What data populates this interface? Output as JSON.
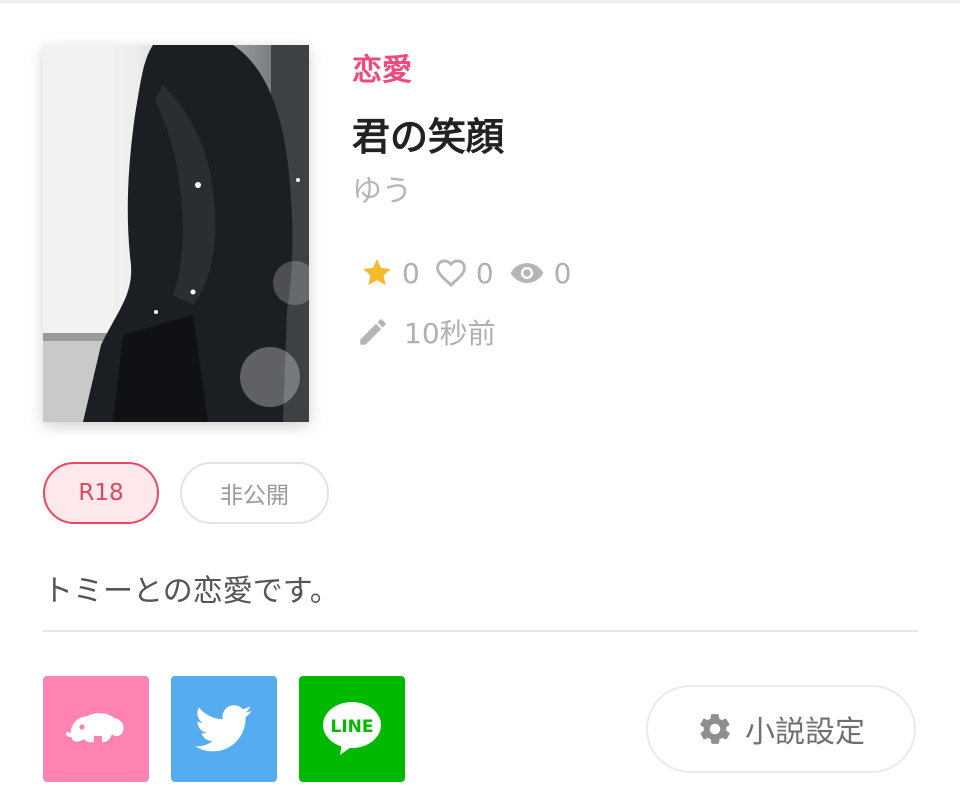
{
  "novel": {
    "genre": "恋愛",
    "title": "君の笑顔",
    "author": "ゆう",
    "stats": {
      "stars": "0",
      "likes": "0",
      "views": "0"
    },
    "updated": "10秒前",
    "tags": {
      "rating": "R18",
      "visibility": "非公開"
    },
    "description": "トミーとの恋愛です。"
  },
  "share": {
    "line_label": "LINE"
  },
  "settings_button": {
    "label": "小説設定"
  },
  "icons": {
    "star": "star-icon",
    "heart": "heart-outline-icon",
    "eye": "eye-icon",
    "pencil": "pencil-icon",
    "elephant": "elephant-icon",
    "twitter": "twitter-bird-icon",
    "line": "line-logo-icon",
    "gear": "gear-icon"
  },
  "colors": {
    "genre": "#ef4a7e",
    "star": "#f6b92b",
    "r18_border": "#ec4760",
    "mamma": "#fe82b2",
    "twitter": "#55acee",
    "line": "#00b900"
  }
}
